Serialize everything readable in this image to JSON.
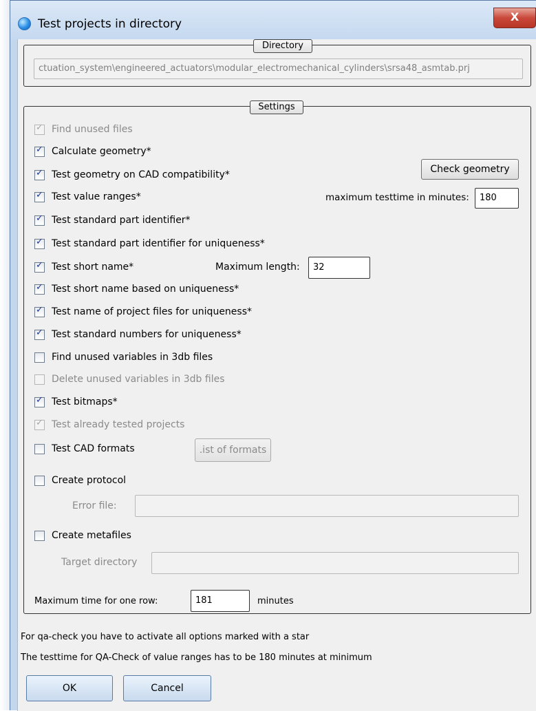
{
  "window": {
    "title": "Test projects in directory",
    "close_glyph": "X"
  },
  "directory": {
    "legend": "Directory",
    "path": "ctuation_system\\engineered_actuators\\modular_electromechanical_cylinders\\srsa48_asmtab.prj"
  },
  "settings": {
    "legend": "Settings",
    "options": [
      {
        "label": "Find unused files",
        "checked": true,
        "enabled": false
      },
      {
        "label": "Calculate geometry*",
        "checked": true,
        "enabled": true
      },
      {
        "label": "Test geometry on CAD compatibility*",
        "checked": true,
        "enabled": true
      },
      {
        "label": "Test value ranges*",
        "checked": true,
        "enabled": true
      },
      {
        "label": "Test standard part identifier*",
        "checked": true,
        "enabled": true
      },
      {
        "label": "Test standard part identifier for uniqueness*",
        "checked": true,
        "enabled": true
      },
      {
        "label": "Test short name*",
        "checked": true,
        "enabled": true
      },
      {
        "label": "Test short name based on uniqueness*",
        "checked": true,
        "enabled": true
      },
      {
        "label": "Test name of project files for uniqueness*",
        "checked": true,
        "enabled": true
      },
      {
        "label": "Test standard numbers for uniqueness*",
        "checked": true,
        "enabled": true
      },
      {
        "label": "Find unused variables in 3db files",
        "checked": false,
        "enabled": true
      },
      {
        "label": "Delete unused variables in 3db files",
        "checked": false,
        "enabled": false
      },
      {
        "label": "Test bitmaps*",
        "checked": true,
        "enabled": true
      },
      {
        "label": "Test already tested projects",
        "checked": true,
        "enabled": false
      },
      {
        "label": "Test CAD formats",
        "checked": false,
        "enabled": true
      },
      {
        "label": "Create protocol",
        "checked": false,
        "enabled": true
      },
      {
        "label": "Create metafiles",
        "checked": false,
        "enabled": true
      }
    ],
    "check_geometry_button": "Check geometry",
    "max_testtime_label": "maximum testtime in minutes:",
    "max_testtime_value": "180",
    "max_length_label": "Maximum length:",
    "max_length_value": "32",
    "list_of_formats_button": ".ist of formats",
    "error_file_label": "Error file:",
    "error_file_value": "",
    "target_directory_label": "Target directory",
    "target_directory_value": "",
    "max_time_row_label": "Maximum time for one row:",
    "max_time_row_value": "181",
    "minutes_label": "minutes"
  },
  "notes": {
    "line1": "For qa-check you have to activate all options marked with a star",
    "line2": "The testtime for QA-Check of value ranges has to be 180 minutes at minimum"
  },
  "buttons": {
    "ok": "OK",
    "cancel": "Cancel"
  }
}
